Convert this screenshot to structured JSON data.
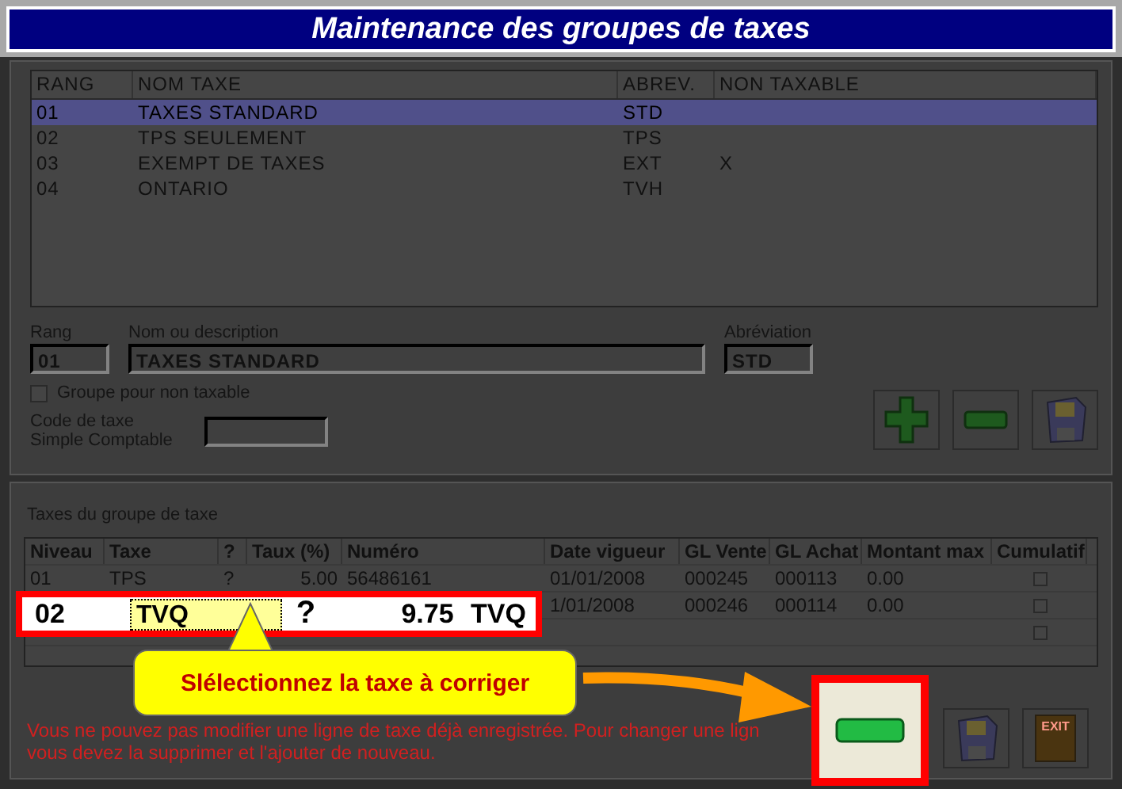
{
  "window": {
    "title": "Maintenance des groupes de taxes"
  },
  "groups_list": {
    "columns": [
      "RANG",
      "NOM TAXE",
      "ABREV.",
      "NON TAXABLE"
    ],
    "rows": [
      {
        "rang": "01",
        "nom": "TAXES STANDARD",
        "abrev": "STD",
        "selected": true
      },
      {
        "rang": "02",
        "nom": "TPS SEULEMENT",
        "abrev": "TPS",
        "selected": false
      },
      {
        "rang": "03",
        "nom": "EXEMPT DE TAXES",
        "abrev": "EXT",
        "non_taxable": "X",
        "selected": false
      },
      {
        "rang": "04",
        "nom": "ONTARIO",
        "abrev": "TVH",
        "selected": false
      }
    ]
  },
  "form": {
    "rang": {
      "label": "Rang",
      "value": "01"
    },
    "nom": {
      "label": "Nom ou description",
      "value": "TAXES STANDARD"
    },
    "abreviation": {
      "label": "Abréviation",
      "value": "STD"
    },
    "non_taxable_group": {
      "label": "Groupe pour non taxable",
      "checked": false
    },
    "code": {
      "label": "Code de taxe\nSimple Comptable"
    }
  },
  "group_buttons": [
    {
      "kind": "add"
    },
    {
      "kind": "remove"
    },
    {
      "kind": "save"
    }
  ],
  "taxes": {
    "label": "Taxes du groupe de taxe",
    "columns": [
      "Niveau",
      "Taxe",
      "?",
      "Taux (%)",
      "Numéro",
      "Date vigueur",
      "GL Vente",
      "GL Achat",
      "Montant max",
      "Cumulatif"
    ],
    "rows": [
      {
        "niveau": "01",
        "taxe": "TPS",
        "q": "?",
        "taux": "5.00",
        "numero": "56486161",
        "date": "01/01/2008",
        "gl_vente": "000245",
        "gl_achat": "000113",
        "montant": "0.00",
        "cumulatif": false
      },
      {
        "date": "1/01/2008",
        "gl_vente": "000246",
        "gl_achat": "000114",
        "montant": "0.00",
        "cumulatif": false
      },
      {
        "cumulatif": false
      }
    ]
  },
  "highlight_row": {
    "niveau": "02",
    "taxe": "TVQ",
    "q": "?",
    "taux": "9.75",
    "abrev": "TVQ"
  },
  "callout": {
    "text": "Slélectionnez la taxe à corriger"
  },
  "message": "Vous ne pouvez pas modifier une ligne de taxe déjà enregistrée. Pour changer une lign\nvous devez la supprimer et l'ajouter de nouveau.",
  "tax_buttons": [
    {
      "kind": "remove",
      "highlighted": true
    },
    {
      "kind": "save",
      "highlighted": false
    },
    {
      "kind": "exit",
      "label": "EXIT",
      "highlighted": false
    }
  ]
}
